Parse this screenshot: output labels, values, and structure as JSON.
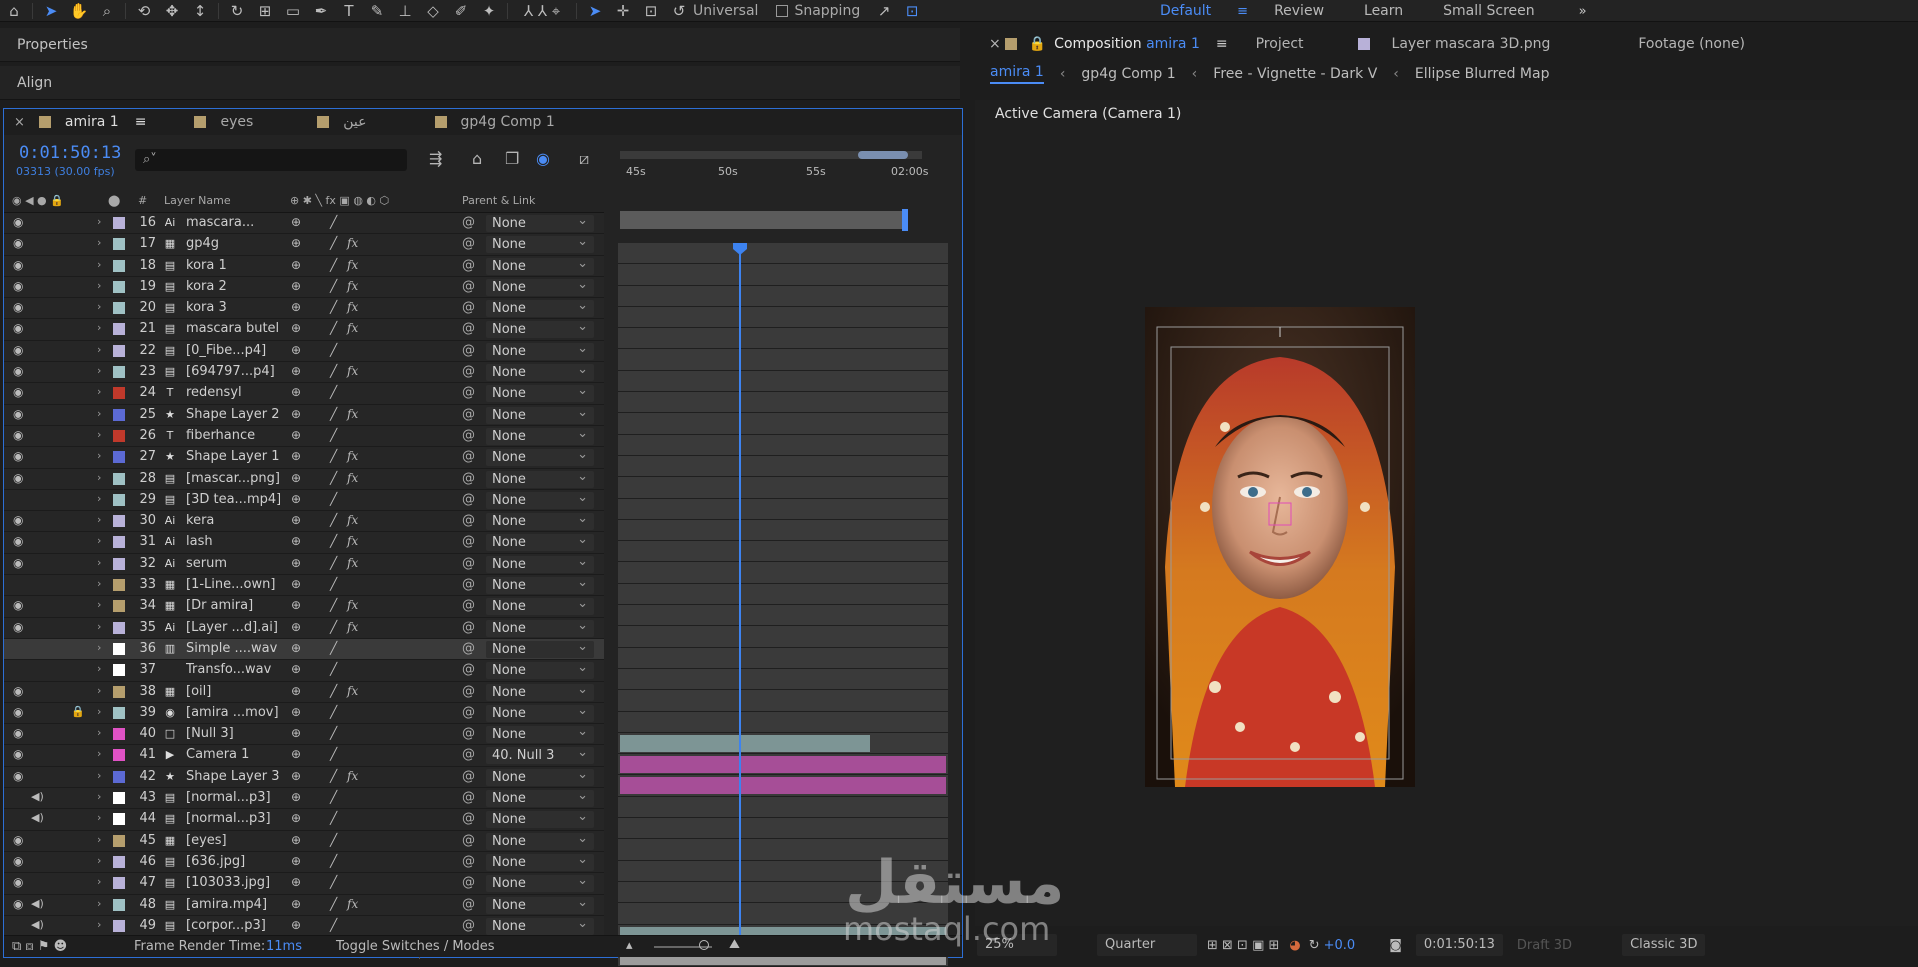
{
  "toolbar": {
    "icons": [
      "home-icon",
      "selection-icon",
      "hand-icon",
      "zoom-icon",
      "orbit-icon",
      "pan-icon",
      "dolly-icon",
      "rotate-icon",
      "anchor-icon",
      "rectangle-icon",
      "pen-icon",
      "text-icon",
      "brush-icon",
      "stamp-icon",
      "eraser-icon",
      "roto-icon",
      "puppet-icon"
    ],
    "axis_mode": "Universal",
    "snapping": "Snapping",
    "workspaces": [
      "Default",
      "Review",
      "Learn",
      "Small Screen"
    ],
    "active_workspace": "Default"
  },
  "panels": {
    "properties": "Properties",
    "align": "Align"
  },
  "timeline": {
    "tabs": [
      {
        "label": "amira 1",
        "color": "#b59e6d",
        "active": true
      },
      {
        "label": "eyes",
        "color": "#b59e6d"
      },
      {
        "label": "عين",
        "color": "#b59e6d"
      },
      {
        "label": "gp4g Comp 1",
        "color": "#b59e6d"
      }
    ],
    "timecode": "0:01:50:13",
    "frames": "03313 (30.00 fps)",
    "search_placeholder": "⌕˅",
    "columns": {
      "layer_name": "Layer Name",
      "parent_link": "Parent & Link",
      "hash": "#"
    },
    "ruler": [
      "45s",
      "50s",
      "55s",
      "02:00s"
    ],
    "footer": {
      "render_label": "Frame Render Time:",
      "render_value": "11ms",
      "toggle": "Toggle Switches / Modes"
    },
    "layers": [
      {
        "num": "16",
        "label": "#b8b1d8",
        "type": "ai",
        "name": "mascara...",
        "eye": true,
        "parent": "None"
      },
      {
        "num": "17",
        "label": "#9fc1c4",
        "type": "comp",
        "name": "gp4g",
        "eye": true,
        "parent": "None",
        "fx": true
      },
      {
        "num": "18",
        "label": "#9fc1c4",
        "type": "file",
        "name": "kora 1",
        "eye": true,
        "parent": "None",
        "fx": true
      },
      {
        "num": "19",
        "label": "#9fc1c4",
        "type": "file",
        "name": "kora 2",
        "eye": true,
        "parent": "None",
        "fx": true
      },
      {
        "num": "20",
        "label": "#9fc1c4",
        "type": "file",
        "name": "kora 3",
        "eye": true,
        "parent": "None",
        "fx": true
      },
      {
        "num": "21",
        "label": "#b8b1d8",
        "type": "file",
        "name": "mascara butel",
        "eye": true,
        "parent": "None",
        "fx": true
      },
      {
        "num": "22",
        "label": "#b8b1d8",
        "type": "file",
        "name": "[0_Fibe...p4]",
        "eye": true,
        "parent": "None"
      },
      {
        "num": "23",
        "label": "#9fc1c4",
        "type": "file",
        "name": "[694797...p4]",
        "eye": true,
        "parent": "None",
        "fx": true
      },
      {
        "num": "24",
        "label": "#c0392b",
        "type": "text",
        "name": "redensyl",
        "eye": true,
        "parent": "None"
      },
      {
        "num": "25",
        "label": "#5c6ad4",
        "type": "shape",
        "name": "Shape Layer 2",
        "eye": true,
        "parent": "None",
        "fx": true
      },
      {
        "num": "26",
        "label": "#c0392b",
        "type": "text",
        "name": "fiberhance",
        "eye": true,
        "parent": "None"
      },
      {
        "num": "27",
        "label": "#5c6ad4",
        "type": "shape",
        "name": "Shape Layer 1",
        "eye": true,
        "parent": "None",
        "fx": true
      },
      {
        "num": "28",
        "label": "#9fc1c4",
        "type": "file",
        "name": "[mascar...png]",
        "eye": true,
        "parent": "None",
        "fx": true
      },
      {
        "num": "29",
        "label": "#9fc1c4",
        "type": "file",
        "name": "[3D tea...mp4]",
        "eye": false,
        "parent": "None"
      },
      {
        "num": "30",
        "label": "#b8b1d8",
        "type": "ai",
        "name": "kera",
        "eye": true,
        "parent": "None",
        "fx": true
      },
      {
        "num": "31",
        "label": "#b8b1d8",
        "type": "ai",
        "name": "lash",
        "eye": true,
        "parent": "None",
        "fx": true
      },
      {
        "num": "32",
        "label": "#b8b1d8",
        "type": "ai",
        "name": "serum",
        "eye": true,
        "parent": "None",
        "fx": true
      },
      {
        "num": "33",
        "label": "#b59e6d",
        "type": "comp",
        "name": "[1-Line...own]",
        "eye": false,
        "parent": "None"
      },
      {
        "num": "34",
        "label": "#b59e6d",
        "type": "comp",
        "name": "[Dr amira]",
        "eye": true,
        "parent": "None",
        "fx": true
      },
      {
        "num": "35",
        "label": "#b8b1d8",
        "type": "ai",
        "name": "[Layer ...d].ai]",
        "eye": true,
        "parent": "None",
        "fx": true
      },
      {
        "num": "36",
        "label": "#ffffff",
        "type": "audio",
        "name": "Simple ....wav",
        "eye": false,
        "parent": "None",
        "selected": true
      },
      {
        "num": "37",
        "label": "#ffffff",
        "type": "none",
        "name": "Transfo...wav",
        "eye": false,
        "parent": "None"
      },
      {
        "num": "38",
        "label": "#b59e6d",
        "type": "comp",
        "name": "[oil]",
        "eye": true,
        "parent": "None",
        "fx": true
      },
      {
        "num": "39",
        "label": "#9fc1c4",
        "type": "cam",
        "name": "[amira ...mov]",
        "eye": true,
        "lock": true,
        "parent": "None"
      },
      {
        "num": "40",
        "label": "#e052c5",
        "type": "null",
        "name": "[Null 3]",
        "eye": true,
        "parent": "None"
      },
      {
        "num": "41",
        "label": "#e052c5",
        "type": "camera",
        "name": "Camera 1",
        "eye": true,
        "parent": "40. Null 3"
      },
      {
        "num": "42",
        "label": "#5c6ad4",
        "type": "shape",
        "name": "Shape Layer 3",
        "eye": true,
        "parent": "None",
        "fx": true
      },
      {
        "num": "43",
        "label": "#ffffff",
        "type": "file",
        "name": "[normal...p3]",
        "eye": false,
        "audio": true,
        "parent": "None"
      },
      {
        "num": "44",
        "label": "#ffffff",
        "type": "file",
        "name": "[normal...p3]",
        "eye": false,
        "audio": true,
        "parent": "None"
      },
      {
        "num": "45",
        "label": "#b59e6d",
        "type": "comp",
        "name": "[eyes]",
        "eye": true,
        "parent": "None"
      },
      {
        "num": "46",
        "label": "#b8b1d8",
        "type": "file",
        "name": "[636.jpg]",
        "eye": true,
        "parent": "None"
      },
      {
        "num": "47",
        "label": "#b8b1d8",
        "type": "file",
        "name": "[103033.jpg]",
        "eye": true,
        "parent": "None"
      },
      {
        "num": "48",
        "label": "#9fc1c4",
        "type": "file",
        "name": "[amira.mp4]",
        "eye": true,
        "audio": true,
        "parent": "None",
        "fx": true
      },
      {
        "num": "49",
        "label": "#b8b1d8",
        "type": "file",
        "name": "[corpor...p3]",
        "eye": false,
        "audio": true,
        "parent": "None"
      }
    ]
  },
  "composition": {
    "tab_prefix": "Composition",
    "tab_name": "amira 1",
    "project": "Project",
    "layer_tab": "Layer  mascara 3D.png",
    "footage_tab": "Footage  (none)",
    "flow": [
      "amira 1",
      "gp4g Comp 1",
      "Free - Vignette - Dark V",
      "Ellipse Blurred Map"
    ],
    "active_camera": "Active Camera (Camera 1)",
    "zoom": "25%",
    "resolution": "Quarter",
    "exposure": "+0.0",
    "timecode": "0:01:50:13",
    "draft3d": "Draft 3D",
    "renderer": "Classic 3D"
  },
  "watermark": {
    "arabic": "مستقل",
    "latin": "mostaql.com"
  }
}
